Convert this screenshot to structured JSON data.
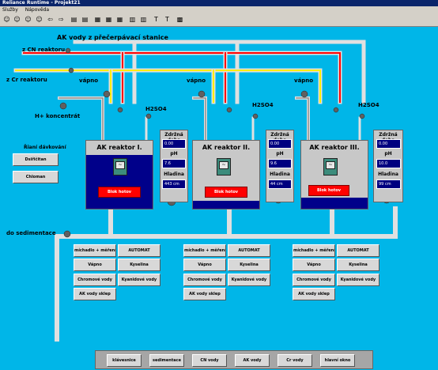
{
  "window": {
    "title": "Reliance Runtime - Projekt21"
  },
  "menu": [
    "Služby",
    "Nápověda"
  ],
  "toolbar_icons": [
    "user-icon",
    "user-icon",
    "user-icon",
    "user-icon",
    "arrow-left-icon",
    "arrow-right-icon",
    "book-icon",
    "book-icon",
    "chart-icon",
    "chart-icon",
    "chart-icon",
    "table-icon",
    "table-icon",
    "text-icon",
    "text-icon",
    "grid-icon"
  ],
  "labels": {
    "ak_voda": "AK vody z přečerpávací stanice",
    "cn": "z CN reaktoru",
    "cr": "z Cr reaktoru",
    "h_plus": "H+ koncentrát",
    "ridici": "Řianí dávkování",
    "sediment": "do sedimentace"
  },
  "dosing": [
    "Dsiřičitan",
    "Chloman"
  ],
  "reactors": [
    {
      "title": "AK reaktor I.",
      "status": "Blok hotov",
      "vapno": "vápno",
      "acid": "H2SO4",
      "zdrzna": "Zdržná doba",
      "zdrzna_val": "0.00",
      "ph": "pH",
      "ph_val": "7.6",
      "hladina": "Hladina",
      "hladina_val": "443 cm"
    },
    {
      "title": "AK reaktor II.",
      "status": "Blok hotov",
      "vapno": "vápno",
      "acid": "H2SO4",
      "zdrzna": "Zdržná doba",
      "zdrzna_val": "0.00",
      "ph": "pH",
      "ph_val": "9.6",
      "hladina": "Hladina",
      "hladina_val": "44 cm"
    },
    {
      "title": "AK reaktor III.",
      "status": "Blok hotov",
      "vapno": "vápno",
      "acid": "H2SO4",
      "zdrzna": "Zdržná doba",
      "zdrzna_val": "0.00",
      "ph": "pH",
      "ph_val": "10.0",
      "hladina": "Hladina",
      "hladina_val": "99 cm"
    }
  ],
  "controls": [
    "míchadlo + měření",
    "AUTOMAT",
    "Vápno",
    "Kyselina",
    "Chromové vody",
    "Kyanidové vody",
    "AK vody sklep"
  ],
  "nav": [
    "klávesnice",
    "sedimentace",
    "CN vody",
    "AK vody",
    "Cr vody",
    "hlavní okno"
  ]
}
